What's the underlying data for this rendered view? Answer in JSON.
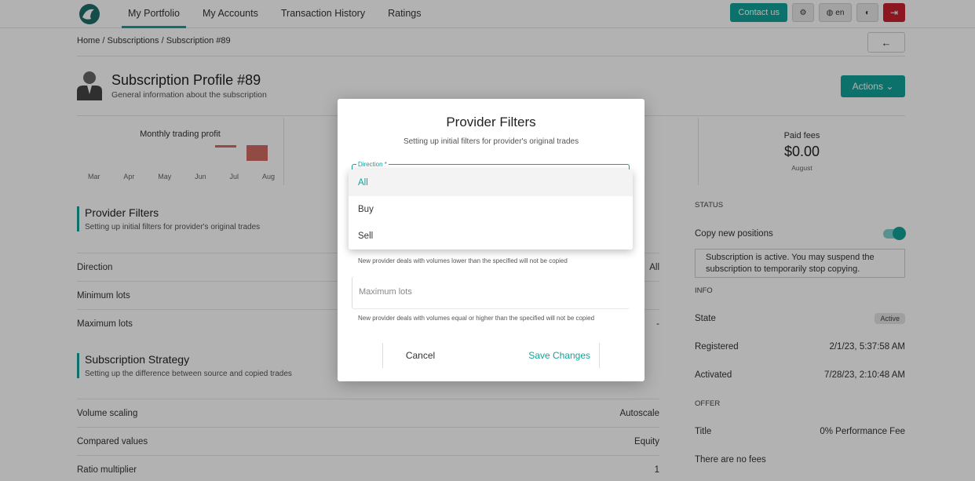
{
  "nav": {
    "items": [
      "My Portfolio",
      "My Accounts",
      "Transaction History",
      "Ratings"
    ],
    "contact_label": "Contact us",
    "lang_label": "en"
  },
  "breadcrumb": "Home / Subscriptions / Subscription #89",
  "header": {
    "title": "Subscription Profile #89",
    "subtitle": "General information about the subscription",
    "actions_label": "Actions"
  },
  "stats": {
    "monthly_profit_title": "Monthly trading profit",
    "months": [
      "Mar",
      "Apr",
      "May",
      "Jun",
      "Jul",
      "Aug"
    ],
    "paid_fees_title": "Paid fees",
    "paid_fees_value": "$0.00",
    "paid_fees_month": "August"
  },
  "chart_data": {
    "type": "bar",
    "title": "Monthly trading profit",
    "categories": [
      "Mar",
      "Apr",
      "May",
      "Jun",
      "Jul",
      "Aug"
    ],
    "values": [
      0,
      0,
      0,
      0,
      -0.15,
      -1
    ],
    "colors": {
      "negative": "#d26b63"
    }
  },
  "provider_filters": {
    "title": "Provider Filters",
    "subtitle": "Setting up initial filters for provider's original trades",
    "rows": [
      {
        "label": "Direction",
        "value": "All"
      },
      {
        "label": "Minimum lots",
        "value": ""
      },
      {
        "label": "Maximum lots",
        "value": "-"
      }
    ]
  },
  "strategy": {
    "title": "Subscription Strategy",
    "subtitle": "Setting up the difference between source and copied trades",
    "rows": [
      {
        "label": "Volume scaling",
        "value": "Autoscale"
      },
      {
        "label": "Compared values",
        "value": "Equity"
      },
      {
        "label": "Ratio multiplier",
        "value": "1"
      }
    ]
  },
  "right_panel": {
    "status_label": "STATUS",
    "copy_label": "Copy new positions",
    "copy_enabled": true,
    "info_text": "Subscription is active. You may suspend the subscription to temporarily stop copying.",
    "info_label": "INFO",
    "state_label": "State",
    "state_value": "Active",
    "registered_label": "Registered",
    "registered_value": "2/1/23, 5:37:58 AM",
    "activated_label": "Activated",
    "activated_value": "7/28/23, 2:10:48 AM",
    "offer_label": "OFFER",
    "title_label": "Title",
    "title_value": "0% Performance Fee",
    "fees_text": "There are no fees"
  },
  "modal": {
    "title": "Provider Filters",
    "subtitle": "Setting up initial filters for provider's original trades",
    "direction_label": "Direction *",
    "options": [
      "All",
      "Buy",
      "Sell"
    ],
    "selected_option": "All",
    "min_hint": "New provider deals with volumes lower than the specified will not be copied",
    "max_placeholder": "Maximum lots",
    "max_hint": "New provider deals with volumes equal or higher than the specified will not be copied",
    "cancel_label": "Cancel",
    "save_label": "Save Changes"
  },
  "colors": {
    "accent": "#14a39a",
    "danger": "#c9222e"
  }
}
